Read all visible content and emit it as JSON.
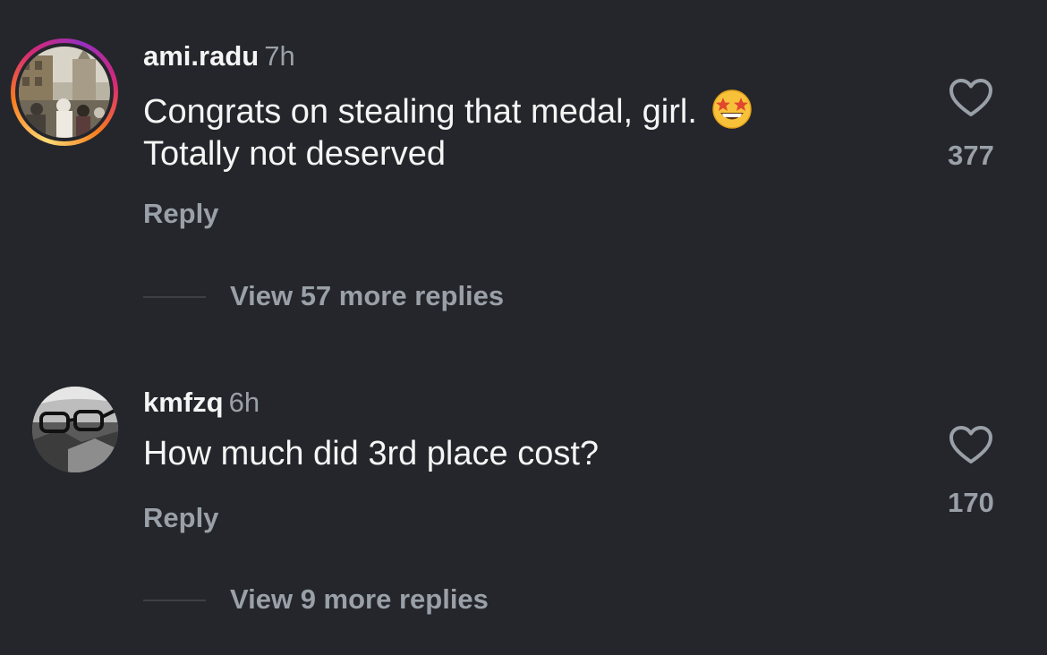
{
  "comments": [
    {
      "username": "ami.radu",
      "time": "7h",
      "text_line1": "Congrats on stealing that medal, girl.",
      "text_line2": "Totally not deserved",
      "emoji": "star-struck-emoji",
      "reply_label": "Reply",
      "more_replies_label": "View 57 more replies",
      "likes": "377",
      "has_story_ring": true
    },
    {
      "username": "kmfzq",
      "time": "6h",
      "text_line1": "How much did 3rd place cost?",
      "reply_label": "Reply",
      "more_replies_label": "View 9 more replies",
      "likes": "170",
      "has_story_ring": false
    }
  ],
  "colors": {
    "background": "#25262b",
    "primary_text": "#f5f5f5",
    "secondary_text": "#9aa0a8",
    "story_ring_start": "#feda75",
    "story_ring_end": "#d62976"
  }
}
